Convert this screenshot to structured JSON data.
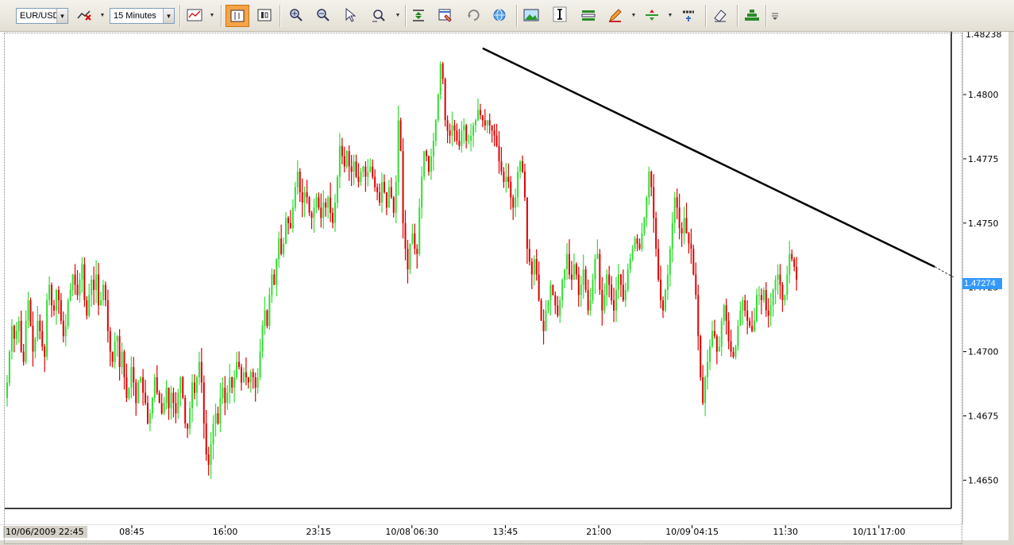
{
  "toolbar": {
    "symbol": "EUR/USD",
    "timeframe": "15 Minutes",
    "buttons": [
      {
        "name": "indicator-remove-icon"
      },
      {
        "name": "chart-type-icon"
      },
      {
        "name": "bar-view-icon"
      },
      {
        "name": "candle-view-icon"
      },
      {
        "name": "zoom-in-icon"
      },
      {
        "name": "zoom-out-icon"
      },
      {
        "name": "cursor-icon"
      },
      {
        "name": "zoom-rect-icon"
      },
      {
        "name": "auto-scroll-icon"
      },
      {
        "name": "properties-icon"
      },
      {
        "name": "refresh-icon"
      },
      {
        "name": "globe-icon"
      },
      {
        "name": "image-icon"
      },
      {
        "name": "text-cursor-icon"
      },
      {
        "name": "list-icon"
      },
      {
        "name": "pencil-icon"
      },
      {
        "name": "line-tool-icon"
      },
      {
        "name": "abc-text-icon"
      },
      {
        "name": "eraser-icon"
      },
      {
        "name": "pyramid-icon"
      },
      {
        "name": "more-icon"
      }
    ]
  },
  "colors": {
    "up": "#33dd33",
    "down": "#dd0000",
    "trendline": "#000000",
    "price_badge": "#3399ff"
  },
  "current_price": "1.47274",
  "chart_data": {
    "type": "candlestick",
    "symbol": "EUR/USD",
    "interval": "15 Minutes",
    "y_top_label": "1.48238",
    "y_ticks": [
      "1.4800",
      "1.4775",
      "1.4750",
      "1.4725",
      "1.4700",
      "1.4675",
      "1.4650"
    ],
    "y_tick_values": [
      1.48,
      1.4775,
      1.475,
      1.4725,
      1.47,
      1.4675,
      1.465
    ],
    "ylim": [
      1.4645,
      1.48238
    ],
    "x_ticks": [
      "10/06/2009 22:45",
      "08:45",
      "16:00",
      "23:15",
      "10/08 06:30",
      "13:45",
      "21:00",
      "10/09 04:15",
      "11:30",
      "10/11 17:00"
    ],
    "trendline": {
      "from_index": 203,
      "from_price": 1.4818,
      "to_index": 396,
      "to_price": 1.4733,
      "extension_to_index": 404,
      "extension_price": 1.4729
    },
    "closes": [
      1.4688,
      1.47,
      1.471,
      1.4705,
      1.4708,
      1.4712,
      1.47,
      1.4696,
      1.4712,
      1.472,
      1.471,
      1.47,
      1.4705,
      1.4712,
      1.4708,
      1.4702,
      1.4698,
      1.472,
      1.4726,
      1.4718,
      1.4716,
      1.4724,
      1.472,
      1.4712,
      1.4706,
      1.471,
      1.472,
      1.4724,
      1.473,
      1.4726,
      1.4722,
      1.4728,
      1.4734,
      1.472,
      1.4714,
      1.4722,
      1.4728,
      1.4724,
      1.473,
      1.4718,
      1.472,
      1.4726,
      1.472,
      1.4708,
      1.47,
      1.4696,
      1.4704,
      1.4706,
      1.4694,
      1.47,
      1.469,
      1.4682,
      1.4686,
      1.4694,
      1.4688,
      1.468,
      1.4688,
      1.469,
      1.4684,
      1.468,
      1.4672,
      1.4676,
      1.4682,
      1.469,
      1.4684,
      1.468,
      1.4676,
      1.468,
      1.4686,
      1.4678,
      1.4684,
      1.468,
      1.4676,
      1.4684,
      1.469,
      1.4682,
      1.4672,
      1.467,
      1.4678,
      1.4688,
      1.4684,
      1.469,
      1.4696,
      1.4688,
      1.4672,
      1.466,
      1.4656,
      1.4664,
      1.4672,
      1.4676,
      1.4672,
      1.4682,
      1.4686,
      1.468,
      1.4684,
      1.469,
      1.4686,
      1.469,
      1.4696,
      1.4694,
      1.4688,
      1.4692,
      1.469,
      1.4688,
      1.4692,
      1.469,
      1.4686,
      1.469,
      1.47,
      1.471,
      1.4716,
      1.471,
      1.4722,
      1.473,
      1.4726,
      1.4736,
      1.4744,
      1.4738,
      1.4742,
      1.4752,
      1.475,
      1.4748,
      1.4756,
      1.4764,
      1.477,
      1.4762,
      1.4758,
      1.4762,
      1.476,
      1.4754,
      1.4752,
      1.4756,
      1.476,
      1.4756,
      1.4752,
      1.4758,
      1.4756,
      1.476,
      1.4754,
      1.475,
      1.4758,
      1.4768,
      1.478,
      1.4776,
      1.4772,
      1.4778,
      1.4772,
      1.477,
      1.4774,
      1.4768,
      1.4766,
      1.477,
      1.4772,
      1.4768,
      1.477,
      1.4772,
      1.4768,
      1.4764,
      1.4762,
      1.4758,
      1.4766,
      1.4762,
      1.4756,
      1.4764,
      1.476,
      1.4754,
      1.4766,
      1.479,
      1.4778,
      1.475,
      1.474,
      1.4732,
      1.4742,
      1.4746,
      1.474,
      1.4738,
      1.4756,
      1.4768,
      1.4778,
      1.4776,
      1.477,
      1.4776,
      1.4782,
      1.479,
      1.48,
      1.4812,
      1.4806,
      1.479,
      1.4786,
      1.4784,
      1.4788,
      1.4786,
      1.4782,
      1.478,
      1.4786,
      1.4788,
      1.4782,
      1.4782,
      1.4784,
      1.4788,
      1.479,
      1.4794,
      1.4792,
      1.479,
      1.4788,
      1.479,
      1.4788,
      1.4786,
      1.4784,
      1.478,
      1.4774,
      1.477,
      1.4766,
      1.4768,
      1.4766,
      1.476,
      1.4756,
      1.476,
      1.477,
      1.4774,
      1.477,
      1.476,
      1.474,
      1.4735,
      1.473,
      1.4736,
      1.473,
      1.472,
      1.4712,
      1.4708,
      1.4716,
      1.472,
      1.4726,
      1.4722,
      1.4718,
      1.4714,
      1.472,
      1.4728,
      1.4732,
      1.4738,
      1.473,
      1.4728,
      1.4734,
      1.473,
      1.4722,
      1.4726,
      1.4732,
      1.4724,
      1.4716,
      1.472,
      1.4728,
      1.4736,
      1.4738,
      1.4724,
      1.4716,
      1.4722,
      1.473,
      1.4726,
      1.472,
      1.4716,
      1.4724,
      1.473,
      1.4726,
      1.472,
      1.4724,
      1.4732,
      1.4736,
      1.474,
      1.4744,
      1.4742,
      1.474,
      1.4746,
      1.4752,
      1.476,
      1.477,
      1.4764,
      1.4752,
      1.474,
      1.4728,
      1.472,
      1.4716,
      1.4724,
      1.473,
      1.474,
      1.475,
      1.476,
      1.4756,
      1.4748,
      1.4746,
      1.4752,
      1.4746,
      1.4742,
      1.474,
      1.473,
      1.4722,
      1.4706,
      1.469,
      1.468,
      1.469,
      1.4696,
      1.4702,
      1.4708,
      1.4706,
      1.47,
      1.4702,
      1.4712,
      1.4718,
      1.4712,
      1.4704,
      1.47,
      1.4698,
      1.4702,
      1.471,
      1.4716,
      1.472,
      1.4716,
      1.4712,
      1.471,
      1.4708,
      1.4712,
      1.4722,
      1.4722,
      1.472,
      1.4724,
      1.4716,
      1.4714,
      1.4718,
      1.4724,
      1.4728,
      1.473,
      1.4726,
      1.472,
      1.4722,
      1.473,
      1.4738,
      1.4736,
      1.4733,
      1.4728
    ],
    "first_ohlc_hint": "open",
    "bar_spacing_px": 2.95,
    "first_bar_x": 8
  }
}
